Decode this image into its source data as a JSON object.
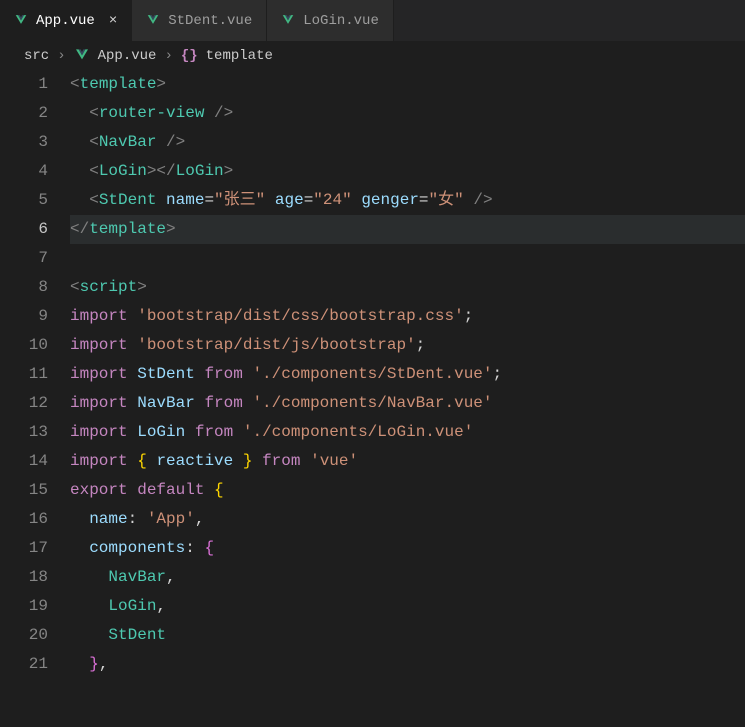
{
  "tabs": [
    {
      "label": "App.vue",
      "active": true
    },
    {
      "label": "StDent.vue",
      "active": false
    },
    {
      "label": "LoGin.vue",
      "active": false
    }
  ],
  "breadcrumb": {
    "seg1": "src",
    "seg2": "App.vue",
    "seg3_prefix": "{}",
    "seg3": "template"
  },
  "code": {
    "l1_tag": "template",
    "l2_tag": "router-view",
    "l3_tag": "NavBar",
    "l4_tag": "LoGin",
    "l5_tag": "StDent",
    "l5_attr1": "name",
    "l5_val1": "\"张三\"",
    "l5_attr2": "age",
    "l5_val2": "\"24\"",
    "l5_attr3": "genger",
    "l5_val3": "\"女\"",
    "l6_tag": "template",
    "l8_tag": "script",
    "l9_import": "import",
    "l9_str": "'bootstrap/dist/css/bootstrap.css'",
    "l10_str": "'bootstrap/dist/js/bootstrap'",
    "l11_ident": "StDent",
    "l11_from": "from",
    "l11_str": "'./components/StDent.vue'",
    "l12_ident": "NavBar",
    "l12_str": "'./components/NavBar.vue'",
    "l13_ident": "LoGin",
    "l13_str": "'./components/LoGin.vue'",
    "l14_ident": "reactive",
    "l14_str": "'vue'",
    "l15_export": "export",
    "l15_default": "default",
    "l16_key": "name",
    "l16_val": "'App'",
    "l17_key": "components",
    "l18": "NavBar",
    "l19": "LoGin",
    "l20": "StDent"
  },
  "lineNumbers": [
    "1",
    "2",
    "3",
    "4",
    "5",
    "6",
    "7",
    "8",
    "9",
    "10",
    "11",
    "12",
    "13",
    "14",
    "15",
    "16",
    "17",
    "18",
    "19",
    "20",
    "21"
  ]
}
